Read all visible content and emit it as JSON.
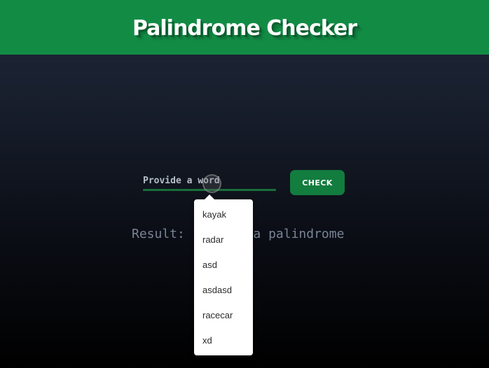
{
  "header": {
    "title": "Palindrome Checker",
    "background_color": "#128c45"
  },
  "form": {
    "input_placeholder": "Provide a word",
    "input_value": "",
    "check_button_label": "CHECK",
    "button_color": "#137c3f"
  },
  "result": {
    "text": "Result:         a palindrome"
  },
  "autocomplete": {
    "items": [
      "kayak",
      "radar",
      "asd",
      "asdasd",
      "racecar",
      "xd"
    ]
  }
}
